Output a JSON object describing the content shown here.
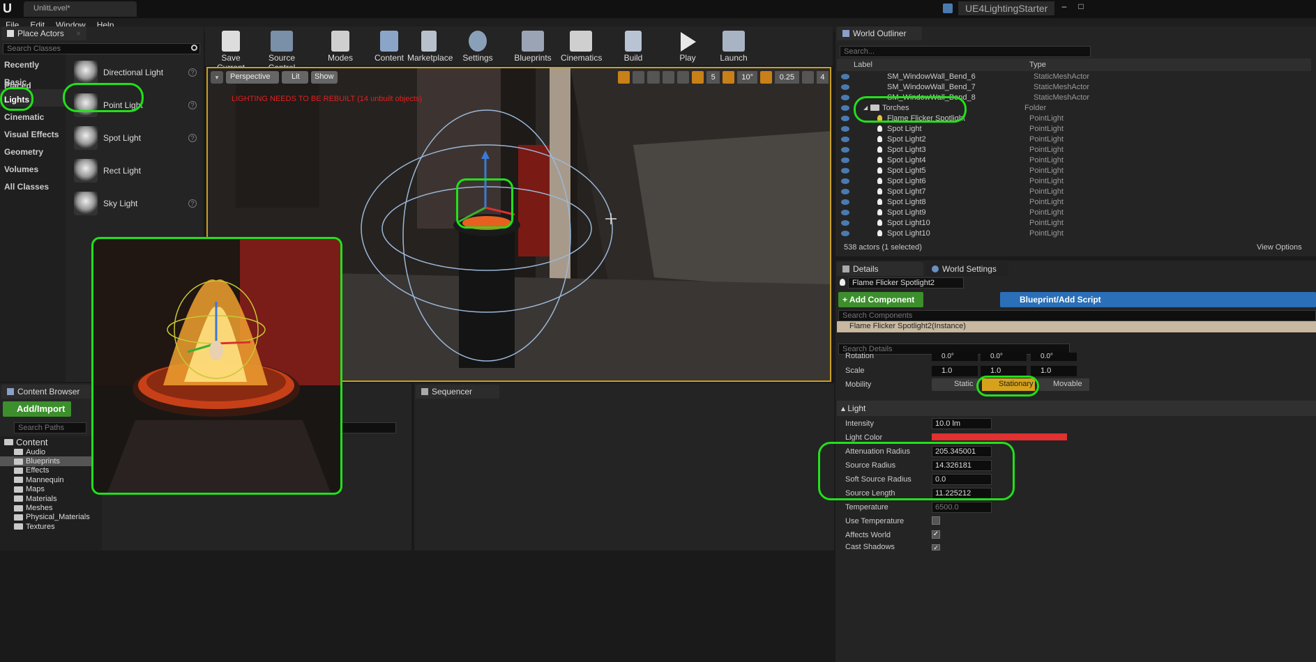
{
  "window": {
    "level_tab": "UnlitLevel*",
    "project": "UE4LightingStarter"
  },
  "menu": [
    "File",
    "Edit",
    "Window",
    "Help"
  ],
  "place_actors": {
    "tab": "Place Actors",
    "search_placeholder": "Search Classes",
    "categories": [
      "Recently Placed",
      "Basic",
      "Lights",
      "Cinematic",
      "Visual Effects",
      "Geometry",
      "Volumes",
      "All Classes"
    ],
    "items": [
      "Directional Light",
      "Point Light",
      "Spot Light",
      "Rect Light",
      "Sky Light"
    ],
    "help_glyph": "?"
  },
  "toolbar": [
    "Save Current",
    "Source Control",
    "Modes",
    "Content",
    "Marketplace",
    "Settings",
    "Blueprints",
    "Cinematics",
    "Build",
    "Play",
    "Launch"
  ],
  "viewport": {
    "perspective": "Perspective",
    "lit": "Lit",
    "show": "Show",
    "warning": "LIGHTING NEEDS TO BE REBUILT (14 unbuilt objects)",
    "grid_snap": "5",
    "rot_snap": "10°",
    "scale_snap": "0.25",
    "cam_speed": "4"
  },
  "outliner": {
    "tab": "World Outliner",
    "search_placeholder": "Search...",
    "col_label": "Label",
    "col_type": "Type",
    "rows": [
      {
        "label": "SM_WindowWall_Bend_6",
        "type": "StaticMeshActor"
      },
      {
        "label": "SM_WindowWall_Bend_7",
        "type": "StaticMeshActor"
      },
      {
        "label": "SM_WindowWall_Bend_8",
        "type": "StaticMeshActor"
      },
      {
        "label": "Torches",
        "type": "Folder"
      },
      {
        "label": "Flame Flicker Spotlight",
        "type": "PointLight"
      },
      {
        "label": "Spot Light",
        "type": "PointLight"
      },
      {
        "label": "Spot Light2",
        "type": "PointLight"
      },
      {
        "label": "Spot Light3",
        "type": "PointLight"
      },
      {
        "label": "Spot Light4",
        "type": "PointLight"
      },
      {
        "label": "Spot Light5",
        "type": "PointLight"
      },
      {
        "label": "Spot Light6",
        "type": "PointLight"
      },
      {
        "label": "Spot Light7",
        "type": "PointLight"
      },
      {
        "label": "Spot Light8",
        "type": "PointLight"
      },
      {
        "label": "Spot Light9",
        "type": "PointLight"
      },
      {
        "label": "Spot Light10",
        "type": "PointLight"
      },
      {
        "label": "Spot Light10",
        "type": "PointLight"
      }
    ],
    "footer": "538 actors (1 selected)",
    "view_options": "View Options"
  },
  "details": {
    "tab": "Details",
    "tab2": "World Settings",
    "actor_name": "Flame Flicker Spotlight2",
    "add_component": "+ Add Component",
    "blueprint_script": "Blueprint/Add Script",
    "search_components": "Search Components",
    "instance": "Flame Flicker Spotlight2(Instance)",
    "search_details": "Search Details",
    "rotation_label": "Rotation",
    "rotation": [
      "0.0°",
      "0.0°",
      "0.0°"
    ],
    "scale_label": "Scale",
    "scale": [
      "1.0",
      "1.0",
      "1.0"
    ],
    "mobility_label": "Mobility",
    "mobility": [
      "Static",
      "Stationary",
      "Movable"
    ],
    "section_light": "Light",
    "props": [
      {
        "label": "Intensity",
        "value": "10.0 lm"
      },
      {
        "label": "Light Color",
        "value": ""
      },
      {
        "label": "Attenuation Radius",
        "value": "205.345001"
      },
      {
        "label": "Source Radius",
        "value": "14.326181"
      },
      {
        "label": "Soft Source Radius",
        "value": "0.0"
      },
      {
        "label": "Source Length",
        "value": "11.225212"
      },
      {
        "label": "Temperature",
        "value": "6500.0"
      },
      {
        "label": "Use Temperature",
        "value": ""
      },
      {
        "label": "Affects World",
        "value": ""
      },
      {
        "label": "Cast Shadows",
        "value": ""
      }
    ],
    "light_color": "#e03030"
  },
  "content_browser": {
    "tab": "Content Browser",
    "add_import": "Add/Import",
    "search_paths": "Search Paths",
    "root": "Content",
    "folders": [
      "Audio",
      "Blueprints",
      "Effects",
      "Mannequin",
      "Maps",
      "Materials",
      "Meshes",
      "Physical_Materials",
      "Textures"
    ]
  },
  "sequencer": {
    "tab": "Sequencer"
  },
  "colors": {
    "highlight": "#22e01a",
    "accent_green": "#3c8f2c",
    "stationary": "#d6a21c",
    "blueprint_btn": "#2a6fb8"
  }
}
